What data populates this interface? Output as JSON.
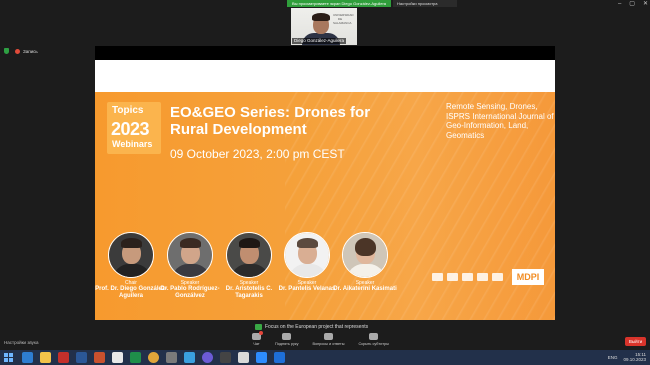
{
  "share": {
    "banner": "Вы просматриваете экран Diego González-Aguilera",
    "view_options": "Настройки просмотра",
    "window_controls": [
      "–",
      "▢",
      "✕"
    ]
  },
  "video": {
    "participant_name": "Diego González-Aguilera",
    "background_logo": "UNIVERSIDAD DE SALAMANCA"
  },
  "recording": {
    "label": "Запись"
  },
  "slide": {
    "topics_label": "Topics",
    "topics_year": "2023",
    "topics_sub": "Webinars",
    "title": "EO&GEO Series: Drones for Rural Development",
    "date": "09 October 2023, 2:00 pm CEST",
    "keywords": "Remote Sensing, Drones, ISPRS International Journal of Geo-Information, Land, Geomatics",
    "speakers": [
      {
        "role": "Chair",
        "name": "Prof. Dr. Diego González-Aguilera"
      },
      {
        "role": "Speaker",
        "name": "Dr. Pablo Rodríguez-Gonzálvez"
      },
      {
        "role": "Speaker",
        "name": "Dr. Aristotelis C. Tagarakis"
      },
      {
        "role": "Speaker",
        "name": "Dr. Pantelis Velanas"
      },
      {
        "role": "Speaker",
        "name": "Dr. Aikaterini Kasimati"
      }
    ],
    "publisher": "MDPI"
  },
  "caption": {
    "text": "Focus on the European project that represents"
  },
  "toolbar": {
    "audio_settings": "Настройки звука",
    "items": [
      "Чат",
      "Поднять руку",
      "Вопросы и ответы",
      "Скрыть субтитры"
    ],
    "leave": "Выйти"
  },
  "taskbar": {
    "language": "ENG",
    "time": "15:11",
    "date": "09.10.2023"
  },
  "colors": {
    "slide_orange": "#f79a2e",
    "share_green": "#2f9e3b",
    "leave_red": "#d9342b",
    "taskbar": "#22304a"
  }
}
